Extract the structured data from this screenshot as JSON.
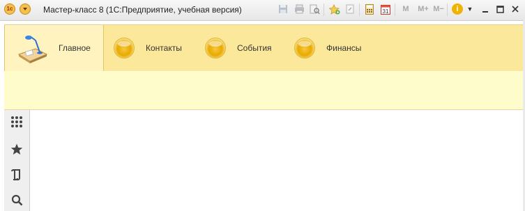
{
  "window": {
    "title": "Мастер-класс 8  (1С:Предприятие, учебная версия)",
    "logo_text": "1с"
  },
  "toolbar": {
    "icons": [
      "save-icon",
      "print-icon",
      "print-preview-icon",
      "add-to-favorites-icon",
      "link-icon",
      "calculator-icon",
      "calendar-icon"
    ],
    "memory_buttons": [
      "M",
      "M+",
      "M−"
    ],
    "info_label": "i"
  },
  "sections": [
    {
      "label": "Главное",
      "active": true,
      "icon": "desktop-lamp-icon"
    },
    {
      "label": "Контакты",
      "active": false,
      "icon": "section-ball-icon"
    },
    {
      "label": "События",
      "active": false,
      "icon": "section-ball-icon"
    },
    {
      "label": "Финансы",
      "active": false,
      "icon": "section-ball-icon"
    }
  ],
  "left_nav": [
    {
      "icon": "all-functions-icon"
    },
    {
      "icon": "favorites-star-icon"
    },
    {
      "icon": "history-icon"
    },
    {
      "icon": "search-icon"
    }
  ]
}
